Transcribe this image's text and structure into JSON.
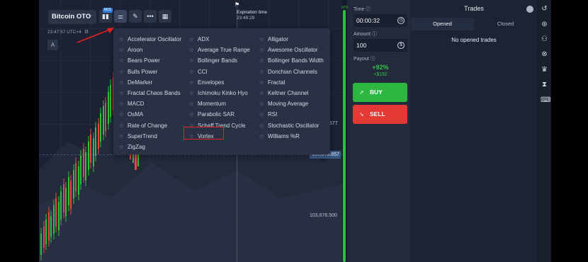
{
  "top_bar": {
    "asset": "Bitcoin OTC",
    "timeframe_badge": "M15",
    "clock": "23:47:57 UTC+4",
    "font_button": "A"
  },
  "expiration": {
    "label": "Expiration time",
    "time": "23:48:29"
  },
  "prices": {
    "current": "103,678.857",
    "level_low": "103,676.500",
    "level_mid": "677"
  },
  "indicators_menu": {
    "columns": [
      [
        "Accelerator Oscillator",
        "Aroon",
        "Bears Power",
        "Bulls Power",
        "DeMarker",
        "Fractal Chaos Bands",
        "MACD",
        "OsMA",
        "Rate of Change",
        "SuperTrend",
        "ZigZag"
      ],
      [
        "ADX",
        "Average True Range",
        "Bollinger Bands",
        "CCI",
        "Envelopes",
        "Ichimoku Kinko Hyo",
        "Momentum",
        "Parabolic SAR",
        "Schaff Trend Cycle",
        "Vortex"
      ],
      [
        "Alligator",
        "Awesome Oscillator",
        "Bollinger Bands Width",
        "Donchian Channels",
        "Fractal",
        "Keltner Channel",
        "Moving Average",
        "RSI",
        "Stochastic Oscillator",
        "Williams %R"
      ]
    ],
    "highlighted": "Vortex"
  },
  "trade_panel": {
    "time_label": "Time",
    "time_value": "00:00:32",
    "amount_label": "Amount",
    "amount_value": "100",
    "payout_label": "Payout",
    "payout_pct": "+92%",
    "payout_amount": "+$192",
    "buy_label": "BUY",
    "sell_label": "SELL",
    "green_pct": "97%"
  },
  "trades_panel": {
    "title": "Trades",
    "tabs": [
      "Opened",
      "Closed"
    ],
    "empty_text": "No opened trades"
  },
  "colors": {
    "buy": "#2db640",
    "sell": "#e53935",
    "accent": "#2f7ee0",
    "highlight": "#e02424"
  },
  "icons": {
    "sidebar": [
      "history-icon",
      "signal-icon",
      "users-icon",
      "close-circle-icon",
      "trophy-icon",
      "hourglass-icon",
      "keyboard-icon"
    ]
  }
}
